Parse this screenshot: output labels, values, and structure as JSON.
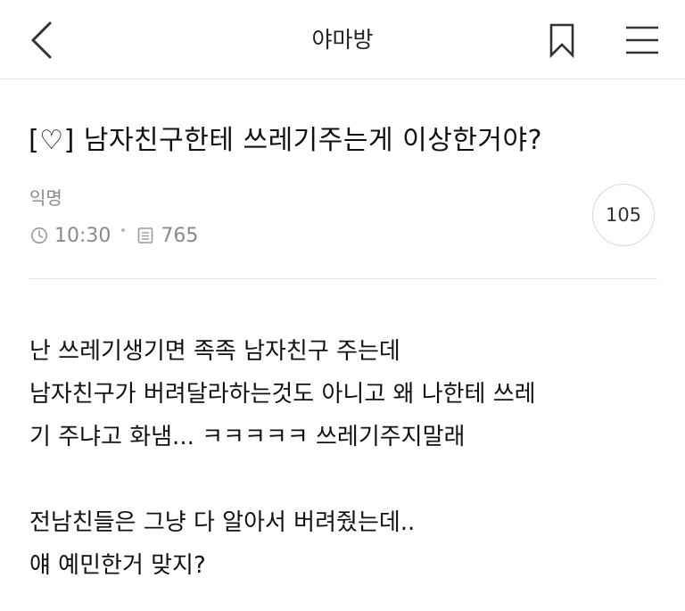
{
  "header": {
    "board_title": "야마방",
    "back_icon": "chevron-left-icon",
    "bookmark_icon": "bookmark-icon",
    "menu_icon": "hamburger-menu-icon"
  },
  "post": {
    "title": "[♡] 남자친구한테 쓰레기주는게 이상한거야?",
    "author": "익명",
    "time": "10:30",
    "views": "765",
    "comment_count": "105",
    "body": {
      "line1": "난 쓰레기생기면 족족 남자친구 주는데",
      "line2": "남자친구가 버려달라하는것도 아니고 왜 나한테 쓰레",
      "line3": "기 주냐고 화냄... ㅋㅋㅋㅋㅋ 쓰레기주지말래",
      "line4": "전남친들은 그냥 다 알아서 버려줬는데..",
      "line5": "얘 예민한거 맞지?"
    }
  },
  "colors": {
    "text": "#111111",
    "meta": "#8a8a8a",
    "divider": "#e4e4e4"
  }
}
